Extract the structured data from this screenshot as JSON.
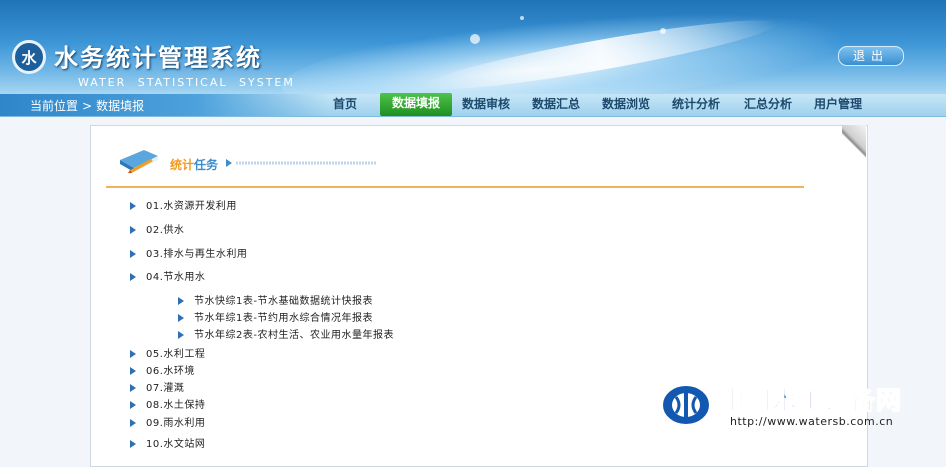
{
  "header": {
    "title": "水务统计管理系统",
    "subtitle": "WATER   STATISTICAL   SYSTEM",
    "logo_glyph": "水",
    "logout_label": "退出"
  },
  "breadcrumb": {
    "prefix": "当前位置",
    "separator": ">",
    "current": "数据填报"
  },
  "nav": {
    "items": [
      {
        "label": "首页",
        "active": false
      },
      {
        "label": "数据填报",
        "active": true
      },
      {
        "label": "数据审核",
        "active": false
      },
      {
        "label": "数据汇总",
        "active": false
      },
      {
        "label": "数据浏览",
        "active": false
      },
      {
        "label": "统计分析",
        "active": false
      },
      {
        "label": "汇总分析",
        "active": false
      },
      {
        "label": "用户管理",
        "active": false
      }
    ],
    "active_color": "#2aa52a"
  },
  "section": {
    "title_part1": "统计",
    "title_part2": "任务"
  },
  "tasks": [
    "01.水资源开发利用",
    "02.供水",
    "03.排水与再生水利用",
    "04.节水用水",
    "节水快综1表-节水基础数据统计快报表",
    "节水年综1表-节约用水综合情况年报表",
    "节水年综2表-农村生活、农业用水量年报表",
    "05.水利工程",
    "06.水环境",
    "07.灌溉",
    "08.水土保持",
    "09.雨水利用",
    "10.水文站网"
  ],
  "watermark": {
    "title": "中国水工设备网",
    "url": "http://www.watersb.com.cn"
  },
  "icons": [
    "logo-emblem-icon",
    "book-pencil-icon",
    "arrow-right-icon",
    "page-curl-icon",
    "watermark-logo-icon"
  ]
}
